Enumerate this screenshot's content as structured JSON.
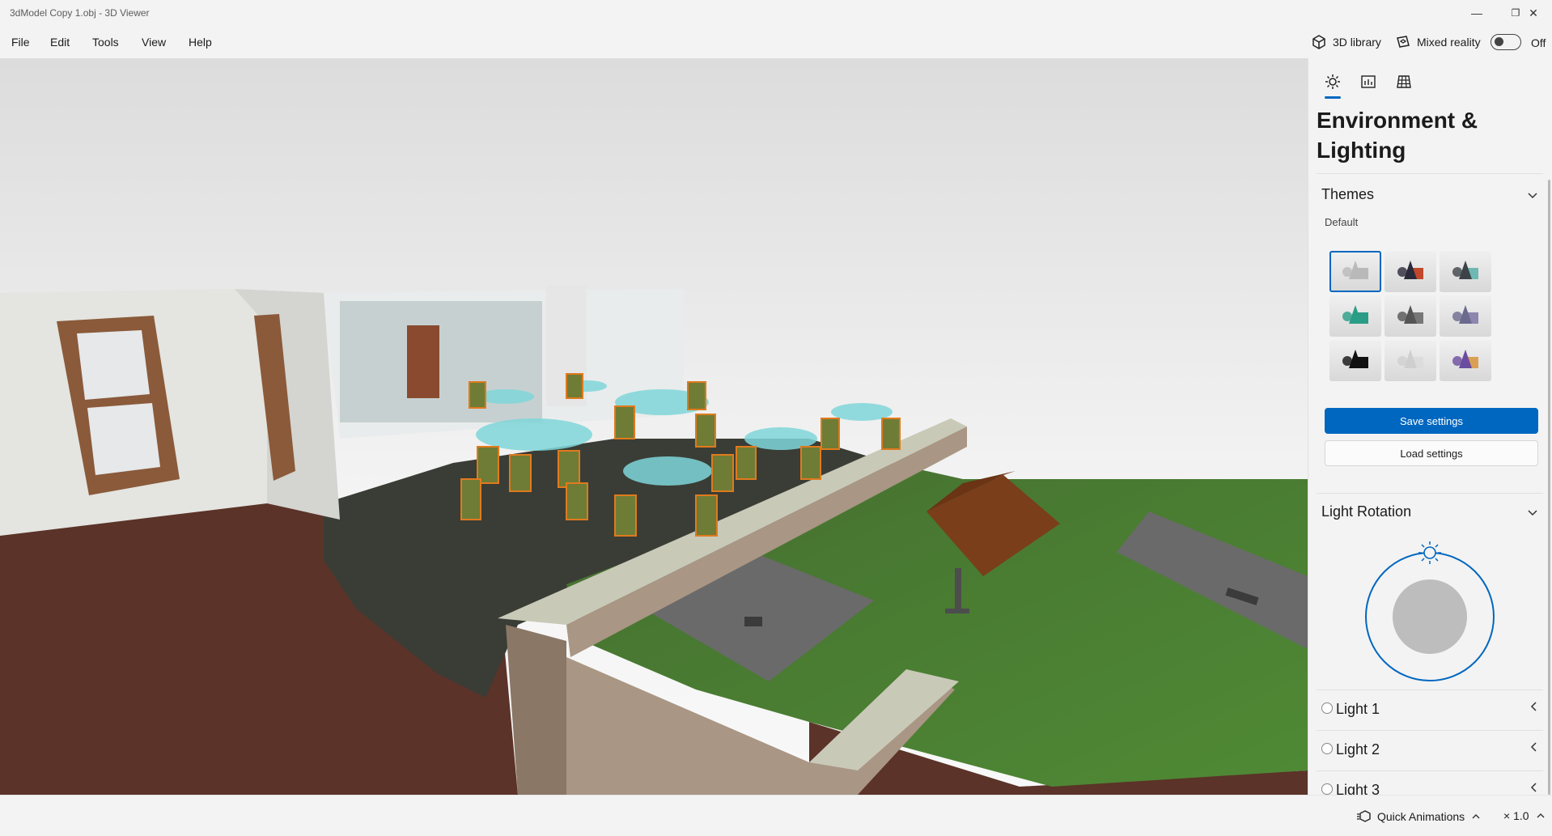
{
  "window": {
    "title": "3dModel Copy 1.obj - 3D Viewer",
    "minimize_glyph": "—",
    "restore_glyph": "❐",
    "close_glyph": "✕"
  },
  "menu": {
    "items": [
      "File",
      "Edit",
      "Tools",
      "View",
      "Help"
    ]
  },
  "commands": {
    "library_label": "3D library",
    "library_icon": "cube-icon",
    "mixed_reality_label": "Mixed reality",
    "mixed_reality_icon": "mixed-reality-icon",
    "mixed_reality_state": "Off"
  },
  "panel": {
    "tabs": [
      {
        "icon": "sun-icon",
        "active": true
      },
      {
        "icon": "stats-icon",
        "active": false
      },
      {
        "icon": "grid-icon",
        "active": false
      }
    ],
    "heading": "Environment & Lighting",
    "themes": {
      "title": "Themes",
      "selected_label": "Default",
      "swatch_colors": [
        [
          "#b9b9b9",
          "#b9b9b9"
        ],
        [
          "#2a2a3a",
          "#c0482c"
        ],
        [
          "#3c4448",
          "#6fb7b3"
        ],
        [
          "#2b9d87",
          "#2b9d87"
        ],
        [
          "#555555",
          "#777777"
        ],
        [
          "#6b6b8f",
          "#8d86ae"
        ],
        [
          "#111111",
          "#111111"
        ],
        [
          "#cfcfcf",
          "#dcdcdc"
        ],
        [
          "#6a4ca0",
          "#d9a054"
        ]
      ],
      "save_label": "Save settings",
      "load_label": "Load settings"
    },
    "light_rotation": {
      "title": "Light Rotation"
    },
    "lights": [
      "Light 1",
      "Light 2",
      "Light 3"
    ]
  },
  "bottom": {
    "quick_animations_label": "Quick Animations",
    "speed_label": "× 1.0"
  },
  "colors": {
    "accent": "#0067c0",
    "grass": "#4a7a34",
    "floor": "#5b3328",
    "glass_table": "#7fd6d9",
    "chair": "#6f7c35",
    "chair_frame": "#e07a1e"
  }
}
